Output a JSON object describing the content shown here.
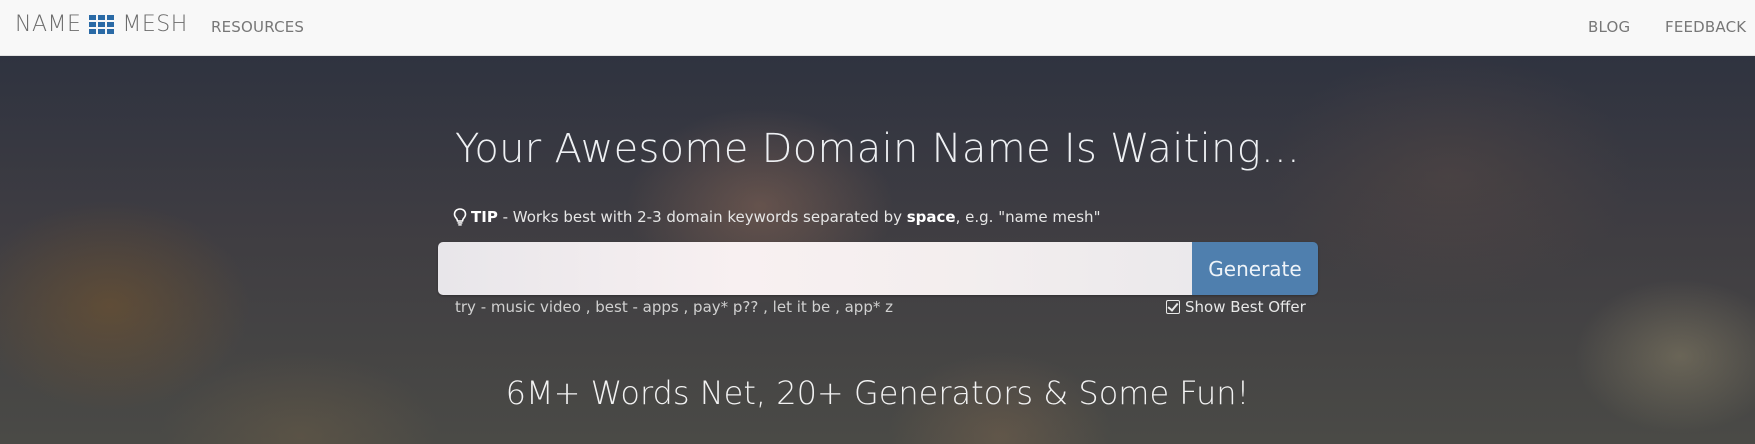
{
  "header": {
    "brand_left": "NAME",
    "brand_right": "MESH",
    "brand_icon": "grid-icon",
    "nav": {
      "resources": "RESOURCES",
      "blog": "BLOG",
      "feedback": "FEEDBACK"
    }
  },
  "hero": {
    "title": "Your Awesome Domain Name Is Waiting...",
    "tip": {
      "icon": "lightbulb-icon",
      "label": "TIP",
      "text_before": " - Works best with 2-3 domain keywords separated by ",
      "emphasis": "space",
      "text_after": ", e.g. \"name mesh\""
    },
    "search": {
      "value": "",
      "placeholder": "",
      "button_label": "Generate"
    },
    "try": {
      "prefix": "try - ",
      "examples": [
        "music video",
        "best - apps",
        "pay* p??",
        "let it be",
        "app* z"
      ],
      "separator": " , "
    },
    "best_offer": {
      "label": "Show Best Offer",
      "checked": true
    },
    "subtitle": "6M+ Words Net, 20+ Generators & Some Fun!"
  },
  "colors": {
    "brand_blue": "#2a6aa6",
    "button_blue": "#4f7fae",
    "navbar_bg": "#f8f8f8"
  }
}
